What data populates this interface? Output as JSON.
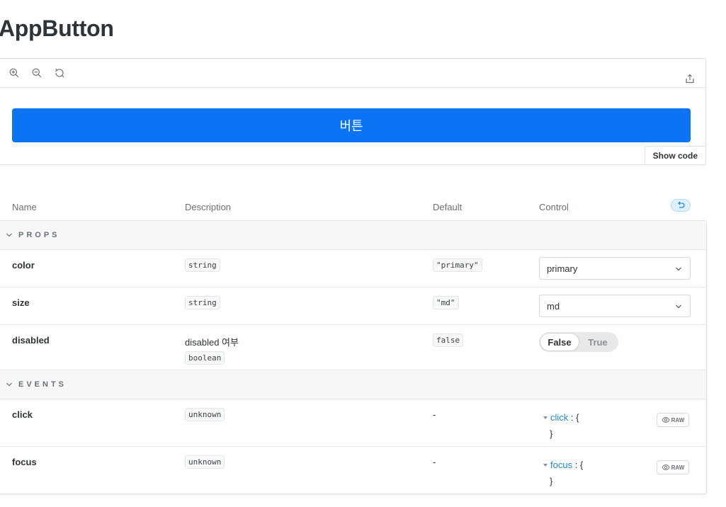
{
  "page": {
    "title": "AppButton"
  },
  "toolbar": {
    "zoom_in_icon": "zoom-in-icon",
    "zoom_out_icon": "zoom-out-icon",
    "reset_icon": "reset-zoom-icon",
    "share_icon": "share-icon"
  },
  "preview": {
    "button_label": "버튼",
    "button_color": "#0a74f5",
    "show_code_label": "Show code"
  },
  "args_table": {
    "headers": {
      "name": "Name",
      "description": "Description",
      "default": "Default",
      "control": "Control"
    },
    "reset_icon": "undo-icon",
    "sections": {
      "props": {
        "label": "PROPS",
        "rows": {
          "color": {
            "name": "color",
            "type": "string",
            "default": "\"primary\"",
            "control_value": "primary"
          },
          "size": {
            "name": "size",
            "type": "string",
            "default": "\"md\"",
            "control_value": "md"
          },
          "disabled": {
            "name": "disabled",
            "description": "disabled 여부",
            "type": "boolean",
            "default": "false",
            "toggle_false": "False",
            "toggle_true": "True",
            "selected": "False"
          }
        }
      },
      "events": {
        "label": "EVENTS",
        "rows": {
          "click": {
            "name": "click",
            "type": "unknown",
            "default": "-",
            "object_key": "click",
            "colon_brace": " : {",
            "close": "}",
            "raw_label": "RAW"
          },
          "focus": {
            "name": "focus",
            "type": "unknown",
            "default": "-",
            "object_key": "focus",
            "colon_brace": " : {",
            "close": "}",
            "raw_label": "RAW"
          }
        }
      }
    }
  }
}
